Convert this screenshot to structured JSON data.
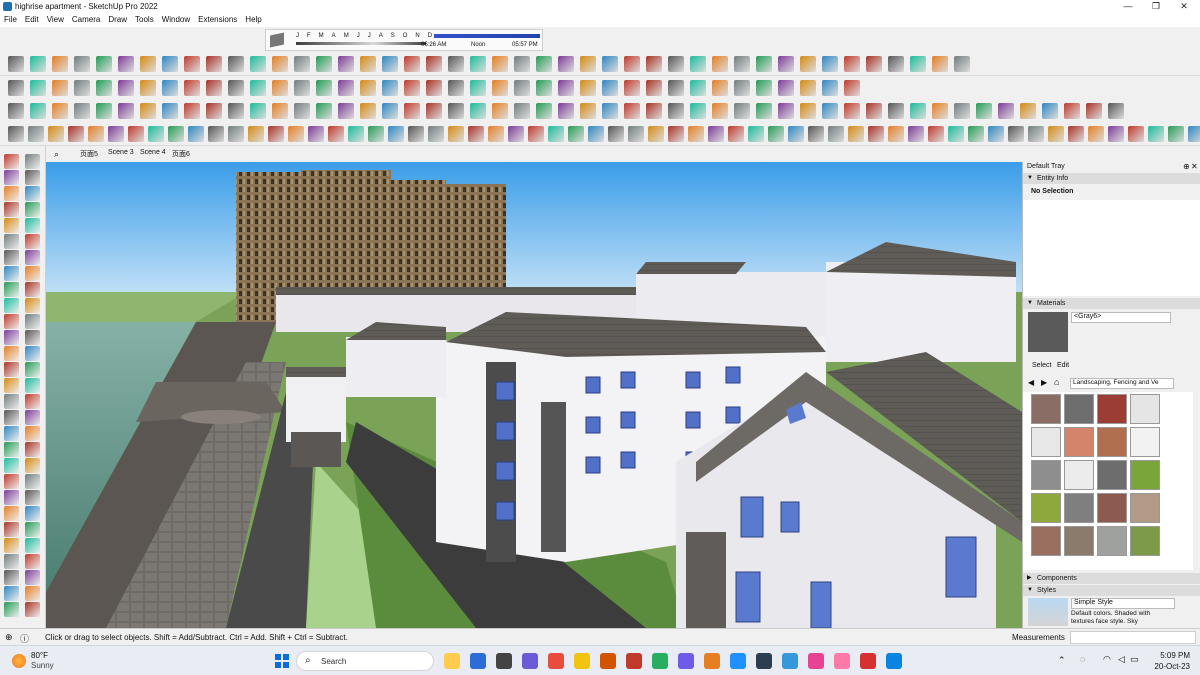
{
  "window": {
    "title": "highrise apartment - SketchUp Pro 2022",
    "controls": [
      "—",
      "❐",
      "✕"
    ]
  },
  "menu": [
    "File",
    "Edit",
    "View",
    "Camera",
    "Draw",
    "Tools",
    "Window",
    "Extensions",
    "Help"
  ],
  "shadow": {
    "months": [
      "J",
      "F",
      "M",
      "A",
      "M",
      "J",
      "J",
      "A",
      "S",
      "O",
      "N",
      "D"
    ],
    "sunrise": "06:26 AM",
    "noon": "Noon",
    "sunset": "05:57 PM"
  },
  "scenes": [
    "页面5",
    "Scene 3",
    "Scene 4",
    "页面6"
  ],
  "tray": {
    "title": "Default Tray",
    "entity_info": {
      "header": "Entity Info",
      "value": "No Selection"
    },
    "materials": {
      "header": "Materials",
      "current": "<Gray6>",
      "tabs": [
        "Select",
        "Edit"
      ],
      "library": "Landscaping, Fencing and Ve",
      "swatch_color": "#5a5a5a"
    },
    "components": {
      "header": "Components"
    },
    "styles": {
      "header": "Styles",
      "name": "Simple Style",
      "description": "Default colors.  Shaded with textures face style.  Sky"
    }
  },
  "status": {
    "hint": "Click or drag to select objects. Shift = Add/Subtract. Ctrl = Add. Shift + Ctrl = Subtract.",
    "measurements_label": "Measurements"
  },
  "taskbar": {
    "temperature": "80°F",
    "condition": "Sunny",
    "search_label": "Search",
    "time": "5:09 PM",
    "date": "20-Oct-23"
  },
  "colors": {
    "sky_top": "#3a9de8",
    "sky_bottom": "#b9dcf7",
    "ground": "#6b9a4a",
    "water": "#5a8c7c"
  }
}
